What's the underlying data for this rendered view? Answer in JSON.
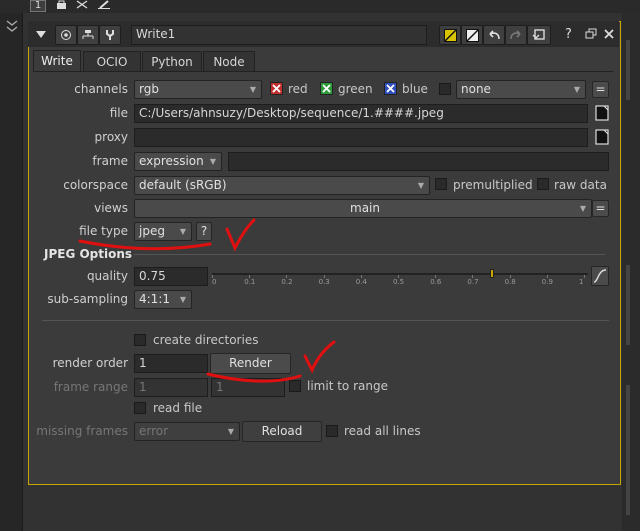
{
  "topbar": {
    "node_number": "1"
  },
  "node": {
    "name": "Write1",
    "help_label": "?"
  },
  "tabs": [
    {
      "label": "Write"
    },
    {
      "label": "OCIO"
    },
    {
      "label": "Python"
    },
    {
      "label": "Node"
    }
  ],
  "knobs": {
    "channels_label": "channels",
    "channels_value": "rgb",
    "red_label": "red",
    "green_label": "green",
    "blue_label": "blue",
    "none_value": "none",
    "equals_label": "=",
    "file_label": "file",
    "file_value": "C:/Users/ahnsuzy/Desktop/sequence/1.####.jpeg",
    "proxy_label": "proxy",
    "frame_label": "frame",
    "frame_value": "expression",
    "colorspace_label": "colorspace",
    "colorspace_value": "default (sRGB)",
    "premultiplied_label": "premultiplied",
    "raw_label": "raw data",
    "views_label": "views",
    "views_value": "main",
    "filetype_label": "file type",
    "filetype_value": "jpeg",
    "filetype_help": "?",
    "jpeg_section": "JPEG Options",
    "quality_label": "quality",
    "quality_value": "0.75",
    "quality_slider": 0.75,
    "quality_ticks": [
      "0",
      "0.1",
      "0.2",
      "0.3",
      "0.4",
      "0.5",
      "0.6",
      "0.7",
      "0.8",
      "0.9",
      "1"
    ],
    "subsampling_label": "sub-sampling",
    "subsampling_value": "4:1:1",
    "create_dirs_label": "create directories",
    "render_order_label": "render order",
    "render_order_value": "1",
    "render_button": "Render",
    "frame_range_label": "frame range",
    "frame_range_start": "1",
    "frame_range_end": "1",
    "limit_label": "limit to range",
    "read_file_label": "read file",
    "missing_frames_label": "missing frames",
    "missing_frames_value": "error",
    "reload_button": "Reload",
    "read_all_lines_label": "read all lines"
  },
  "colors": {
    "panel_border": "#c8a400",
    "annotation": "#e01010",
    "red_check": "#c0302f",
    "green_check": "#2f9a3a",
    "blue_check": "#2f4fbf"
  }
}
